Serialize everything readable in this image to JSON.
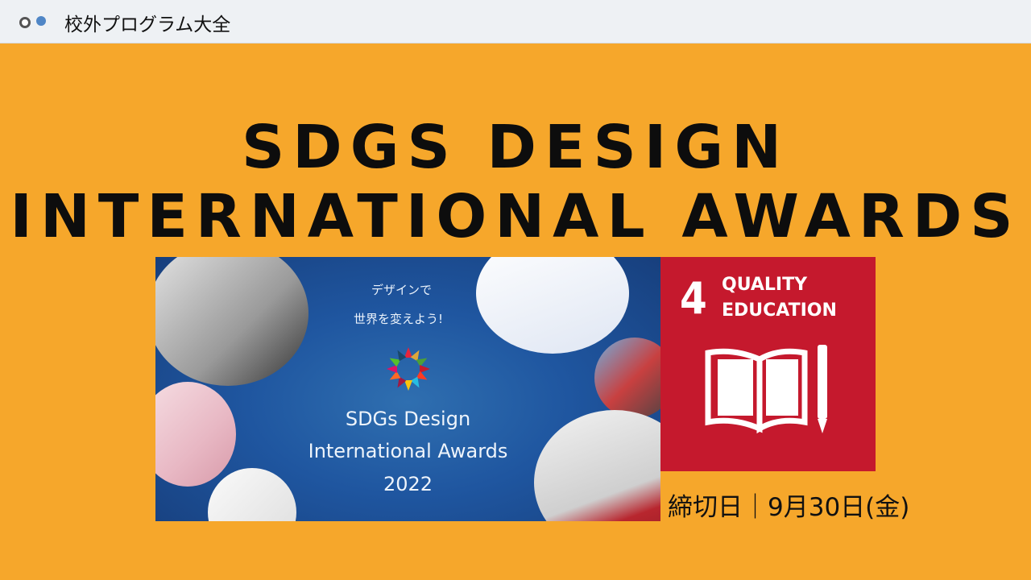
{
  "topbar": {
    "title": "校外プログラム大全"
  },
  "headline": {
    "line1": "SDGS DESIGN",
    "line2": "INTERNATIONAL AWARDS"
  },
  "banner": {
    "jp_line1": "デザインで",
    "jp_line2": "世界を変えよう!",
    "title_line1": "SDGs Design",
    "title_line2": "International Awards",
    "year": "2022"
  },
  "sdg": {
    "number": "4",
    "label_line1": "QUALITY",
    "label_line2": "EDUCATION",
    "color": "#c5192d",
    "icon": "book-pencil-icon"
  },
  "deadline": {
    "text": "締切日｜9月30日(金)"
  },
  "colors": {
    "background": "#f6a72b",
    "banner": "#1f56a0"
  }
}
